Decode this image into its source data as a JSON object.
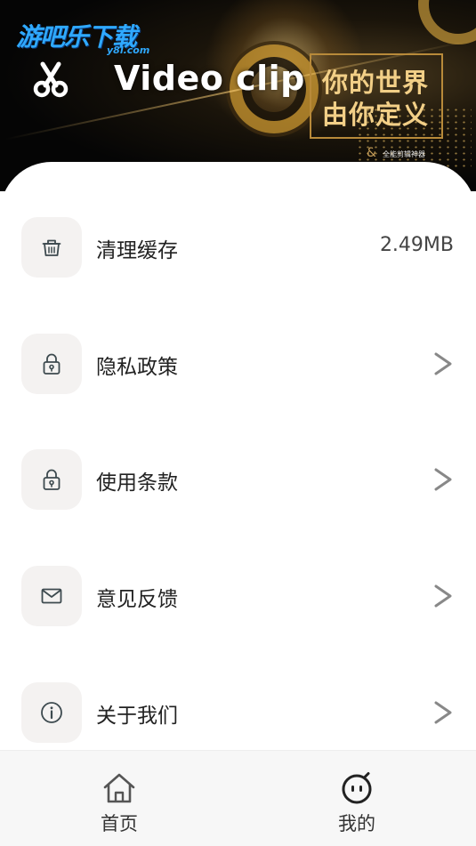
{
  "banner": {
    "watermark_main": "游吧乐下载",
    "watermark_sub": "y8l.com",
    "title": "Video clip",
    "slogan_line1": "你的世界",
    "slogan_line2": "由你定义",
    "small_text": "全能剪辑神器",
    "amp": "&"
  },
  "settings": {
    "items": [
      {
        "label": "清理缓存",
        "value": "2.49MB",
        "icon": "trash-icon"
      },
      {
        "label": "隐私政策",
        "icon": "lock-icon"
      },
      {
        "label": "使用条款",
        "icon": "lock-icon"
      },
      {
        "label": "意见反馈",
        "icon": "mail-icon"
      },
      {
        "label": "关于我们",
        "icon": "info-icon"
      }
    ]
  },
  "tabbar": {
    "tabs": [
      {
        "label": "首页",
        "icon": "home-icon"
      },
      {
        "label": "我的",
        "icon": "face-icon"
      }
    ]
  },
  "colors": {
    "icon_bg": "#f4f2f1",
    "icon_stroke": "#3d4a4f",
    "chevron": "#888888",
    "tabbar_bg": "#f7f7f7",
    "watermark_blue": "#2fa9ff",
    "slogan_gold": "#f2cf87"
  }
}
